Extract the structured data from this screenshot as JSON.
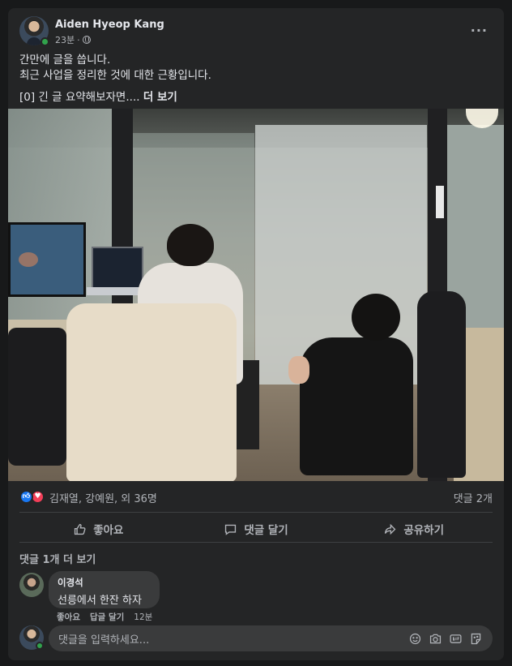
{
  "post": {
    "author": "Aiden Hyeop Kang",
    "time": "23분",
    "dot": "·",
    "text_lines": [
      "간만에 글을 씁니다.",
      "최근 사업을 정리한 것에 대한 근황입니다."
    ],
    "summary": "[0] 긴 글 요약해보자면....",
    "see_more": "더 보기"
  },
  "reactions": {
    "names": "김재열, 강예원, 외 36명",
    "comments_count": "댓글 2개",
    "icons": [
      "like-icon",
      "love-icon"
    ]
  },
  "actions": {
    "like": "좋아요",
    "comment": "댓글 달기",
    "share": "공유하기"
  },
  "comments": {
    "view_more": "댓글 1개 더 보기",
    "items": [
      {
        "author": "이경석",
        "text": "선릉에서 한잔 하자",
        "like": "좋아요",
        "reply": "답글 달기",
        "time": "12분"
      }
    ]
  },
  "composer": {
    "placeholder": "댓글을 입력하세요...",
    "tools": [
      "emoji-icon",
      "camera-icon",
      "gif-icon",
      "sticker-icon"
    ]
  },
  "colors": {
    "background": "#18191a",
    "card": "#242526",
    "text": "#e4e6eb",
    "muted": "#b0b3b8",
    "like_blue": "#1877f2",
    "love_red": "#f33e58",
    "online_green": "#31a24c"
  }
}
